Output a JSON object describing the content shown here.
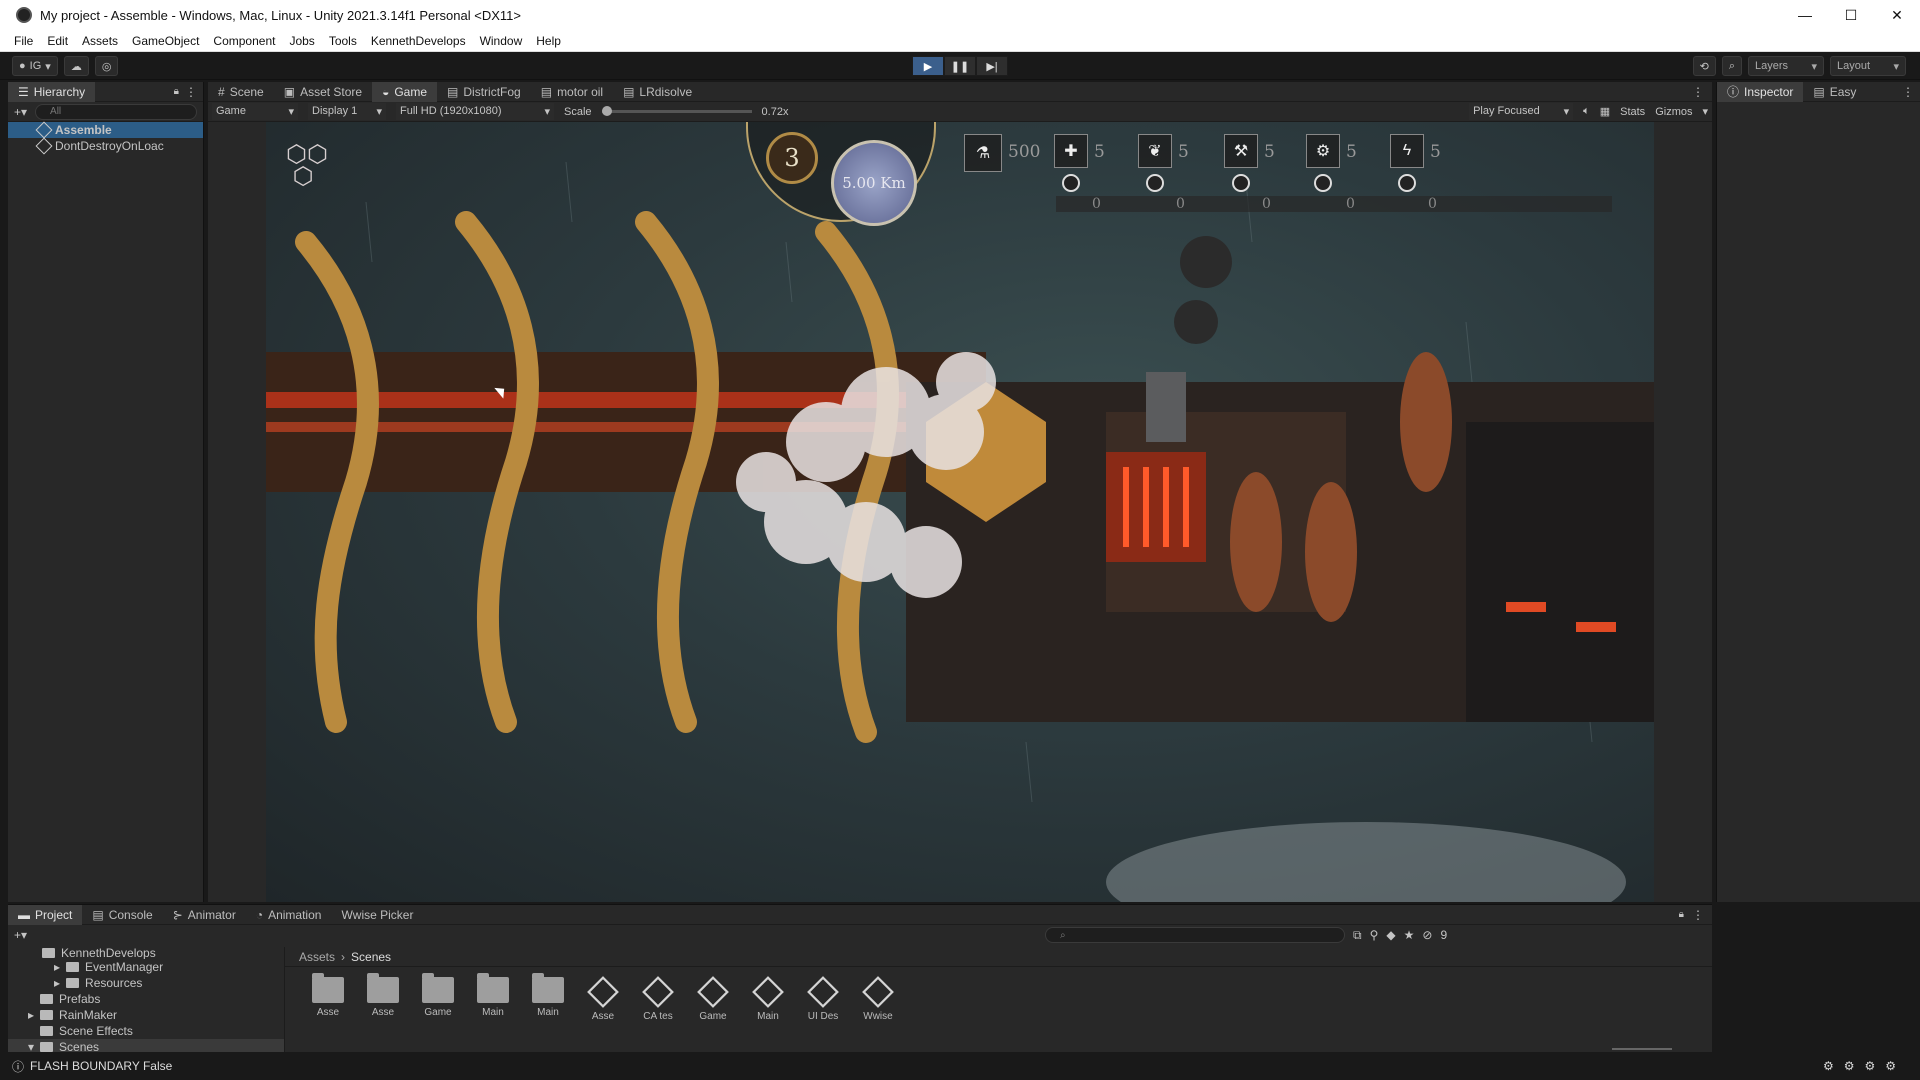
{
  "window": {
    "title": "My project - Assemble - Windows, Mac, Linux - Unity 2021.3.14f1 Personal <DX11>",
    "controls": [
      "—",
      "☐",
      "✕"
    ]
  },
  "menu": [
    "File",
    "Edit",
    "Assets",
    "GameObject",
    "Component",
    "Jobs",
    "Tools",
    "KennethDevelops",
    "Window",
    "Help"
  ],
  "toolbar": {
    "account": "IG",
    "play": "▶",
    "pause": "❚❚",
    "step": "▶|",
    "layers": "Layers",
    "layout": "Layout"
  },
  "hierarchy": {
    "tab": "Hierarchy",
    "search_placeholder": "All",
    "rows": [
      "Assemble",
      "DontDestroyOnLoac"
    ]
  },
  "center_tabs": [
    "Scene",
    "Asset Store",
    "Game",
    "DistrictFog",
    "motor oil",
    "LRdisolve"
  ],
  "game_options": {
    "view": "Game",
    "display": "Display 1",
    "resolution": "Full HD (1920x1080)",
    "scale_label": "Scale",
    "scale_value": "0.72x",
    "play_focused": "Play Focused",
    "stats": "Stats",
    "gizmos": "Gizmos"
  },
  "hud": {
    "level": "3",
    "distance": "5.00 Km",
    "resource": "500",
    "counts": [
      "5",
      "5",
      "5",
      "5",
      "5"
    ],
    "sub_counts": [
      "0",
      "0",
      "0",
      "0",
      "0"
    ]
  },
  "inspector": {
    "tab": "Inspector",
    "tab2": "Easy"
  },
  "bottom_tabs": [
    "Project",
    "Console",
    "Animator",
    "Animation",
    "Wwise Picker"
  ],
  "project": {
    "tree": [
      "KennethDevelops",
      "EventManager",
      "Resources",
      "Prefabs",
      "RainMaker",
      "Scene Effects",
      "Scenes"
    ],
    "breadcrumb": [
      "Assets",
      "Scenes"
    ],
    "assets": [
      {
        "label": "Asse",
        "kind": "folder"
      },
      {
        "label": "Asse",
        "kind": "folder"
      },
      {
        "label": "Game",
        "kind": "folder"
      },
      {
        "label": "Main",
        "kind": "folder"
      },
      {
        "label": "Main",
        "kind": "folder"
      },
      {
        "label": "Asse",
        "kind": "scene"
      },
      {
        "label": "CA tes",
        "kind": "scene"
      },
      {
        "label": "Game",
        "kind": "scene"
      },
      {
        "label": "Main",
        "kind": "scene"
      },
      {
        "label": "UI Des",
        "kind": "scene"
      },
      {
        "label": "Wwise",
        "kind": "scene"
      }
    ],
    "hidden_count": "9"
  },
  "status": "FLASH BOUNDARY False"
}
